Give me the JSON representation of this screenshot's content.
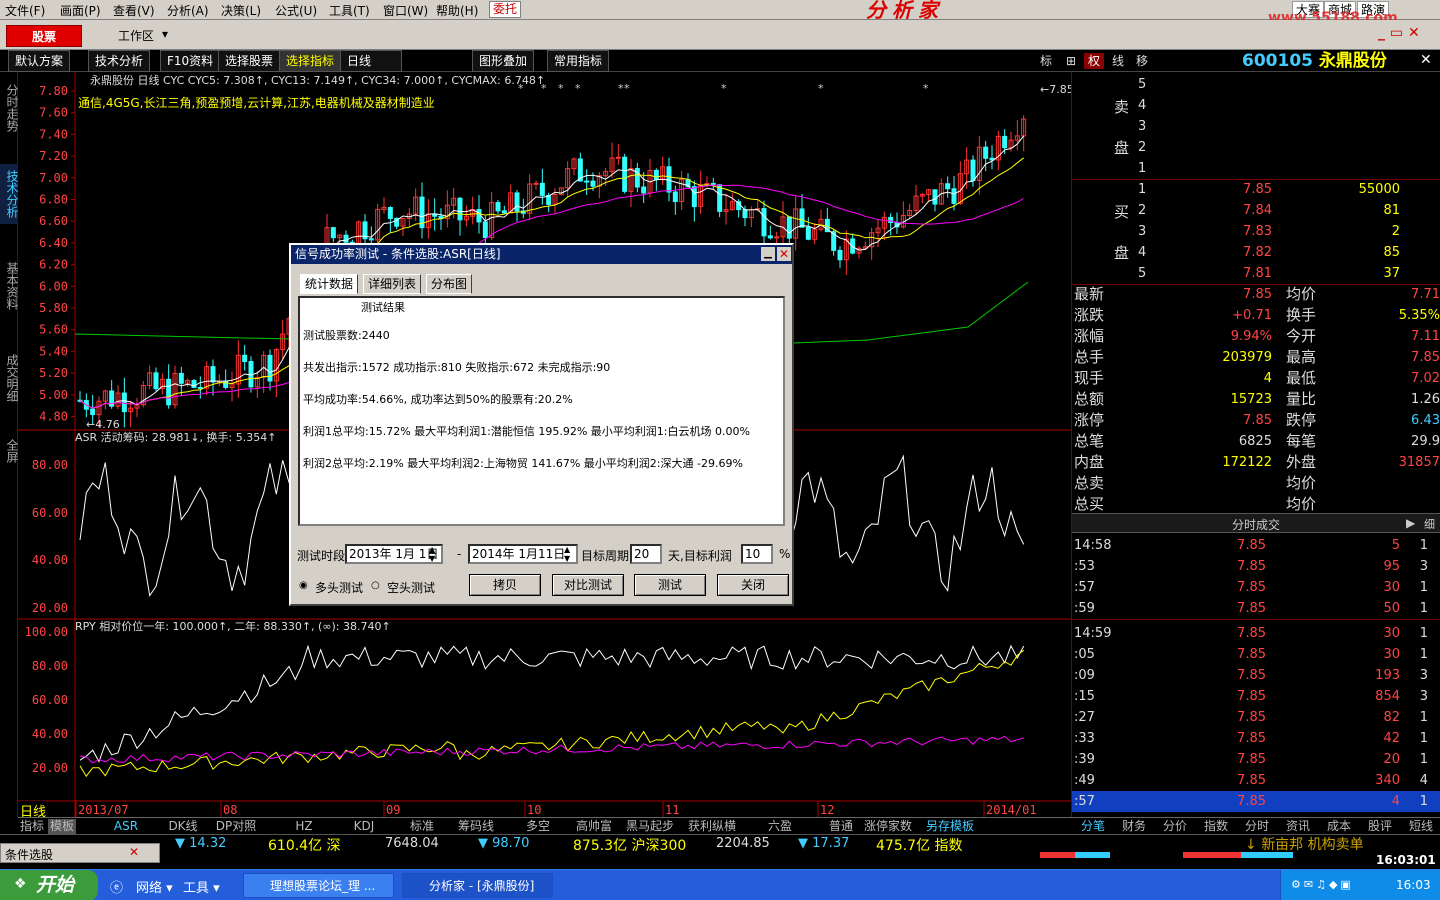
{
  "menu": [
    "文件(F)",
    "画面(P)",
    "查看(V)",
    "分析(A)",
    "决策(L)",
    "公式(U)",
    "工具(T)",
    "窗口(W)",
    "帮助(H)"
  ],
  "entrust": "委托",
  "brand": "分析家",
  "site": {
    "links": [
      "大赛",
      "商城",
      "路演"
    ],
    "url": "www.55188.com"
  },
  "topbar": {
    "stock_button": "股票",
    "workspace": "工作区"
  },
  "toolbar": {
    "items": [
      "默认方案",
      "技术分析",
      "F10资料",
      "选择股票",
      "选择指标",
      "日线",
      "图形叠加",
      "常用指标"
    ],
    "right_buttons": [
      "标",
      "⊞",
      "权",
      "线",
      "移"
    ],
    "stock_code": "600105",
    "stock_name": "永鼎股份"
  },
  "vtabs": [
    "分时走势",
    "技术分析",
    "基本资料",
    "成交明细",
    "全屏"
  ],
  "chart": {
    "kline_title": "永鼎股份 日线 CYC CYC5: 7.308↑, CYC13: 7.149↑, CYC34: 7.000↑, CYCMAX: 6.748↑",
    "concepts": "通信,4G5G,长江三角,预盈预增,云计算,江苏,电器机械及器材制造业",
    "price_ticks": [
      "7.80",
      "7.60",
      "7.40",
      "7.20",
      "7.00",
      "6.80",
      "6.60",
      "6.40",
      "6.20",
      "6.00",
      "5.80",
      "5.60",
      "5.40",
      "5.20",
      "5.00",
      "4.80"
    ],
    "high_label": "7.85",
    "low_label": "4.76",
    "asr_title": "ASR 活动筹码: 28.981↓, 换手: 5.354↑",
    "asr_ticks": [
      "80.00",
      "60.00",
      "40.00",
      "20.00"
    ],
    "rpy_title": "RPY 相对价位一年: 100.000↑, 二年: 88.330↑, (∞): 38.740↑",
    "rpy_ticks": [
      "100.00",
      "80.00",
      "60.00",
      "40.00",
      "20.00"
    ],
    "x_labels": [
      "2013/07",
      "08",
      "09",
      "10",
      "11",
      "12",
      "2014/01"
    ],
    "period_label": "日线"
  },
  "chart_data": {
    "type": "line",
    "series": [
      {
        "name": "CYC5",
        "values": [
          7.308
        ]
      },
      {
        "name": "CYC13",
        "values": [
          7.149
        ]
      },
      {
        "name": "CYC34",
        "values": [
          7.0
        ]
      },
      {
        "name": "CYCMAX",
        "values": [
          6.748
        ]
      }
    ]
  },
  "dialog": {
    "title": "信号成功率测试 - 条件选股:ASR[日线]",
    "tabs": [
      "统计数据",
      "详细列表",
      "分布图"
    ],
    "result_heading": "测试结果",
    "lines": [
      "测试股票数:2440",
      "共发出指示:1572 成功指示:810 失败指示:672 未完成指示:90",
      "平均成功率:54.66%, 成功率达到50%的股票有:20.2%",
      "利润1总平均:15.72% 最大平均利润1:潜能恒信 195.92% 最小平均利润1:白云机场 0.00%",
      "利润2总平均:2.19% 最大平均利润2:上海物贸 141.67% 最小平均利润2:深大通 -29.69%"
    ],
    "period_label": "测试时段",
    "date_from": "2013年 1月 1日",
    "dash": "-",
    "date_to": "2014年 1月11日",
    "target_period_label": "目标周期",
    "target_period": "20",
    "day_label": "天,目标利润",
    "target_profit": "10",
    "pct": "%",
    "radio_long": "多头测试",
    "radio_short": "空头测试",
    "buttons": [
      "拷贝",
      "对比测试",
      "测试",
      "关闭"
    ]
  },
  "orderbook": {
    "sell_label": [
      "卖",
      "盘"
    ],
    "buy_label": [
      "买",
      "盘"
    ],
    "sells": [
      {
        "n": "5"
      },
      {
        "n": "4"
      },
      {
        "n": "3"
      },
      {
        "n": "2"
      },
      {
        "n": "1"
      }
    ],
    "buys": [
      {
        "n": "1",
        "p": "7.85",
        "v": "55000"
      },
      {
        "n": "2",
        "p": "7.84",
        "v": "81"
      },
      {
        "n": "3",
        "p": "7.83",
        "v": "2"
      },
      {
        "n": "4",
        "p": "7.82",
        "v": "85"
      },
      {
        "n": "5",
        "p": "7.81",
        "v": "37"
      }
    ]
  },
  "quote": [
    {
      "l": "最新",
      "v": "7.85",
      "l2": "均价",
      "v2": "7.71"
    },
    {
      "l": "涨跌",
      "v": "+0.71",
      "l2": "换手",
      "v2": "5.35%"
    },
    {
      "l": "涨幅",
      "v": "9.94%",
      "l2": "今开",
      "v2": "7.11"
    },
    {
      "l": "总手",
      "v": "203979",
      "l2": "最高",
      "v2": "7.85"
    },
    {
      "l": "现手",
      "v": "4",
      "l2": "最低",
      "v2": "7.02"
    },
    {
      "l": "总额",
      "v": "15723",
      "l2": "量比",
      "v2": "1.26"
    },
    {
      "l": "涨停",
      "v": "7.85",
      "l2": "跌停",
      "v2": "6.43"
    },
    {
      "l": "总笔",
      "v": "6825",
      "l2": "每笔",
      "v2": "29.9"
    },
    {
      "l": "内盘",
      "v": "172122",
      "l2": "外盘",
      "v2": "31857"
    },
    {
      "l": "总卖",
      "v": "",
      "l2": "均价",
      "v2": ""
    },
    {
      "l": "总买",
      "v": "",
      "l2": "均价",
      "v2": ""
    }
  ],
  "ticks_header": "分时成交",
  "ticks_button": "细",
  "ticks": [
    {
      "t": "14:58",
      "p": "7.85",
      "v": "5",
      "n": "1"
    },
    {
      "t": ":53",
      "p": "7.85",
      "v": "95",
      "n": "3"
    },
    {
      "t": ":57",
      "p": "7.85",
      "v": "30",
      "n": "1"
    },
    {
      "t": ":59",
      "p": "7.85",
      "v": "50",
      "n": "1"
    },
    {
      "t": "14:59",
      "p": "7.85",
      "v": "30",
      "n": "1"
    },
    {
      "t": ":05",
      "p": "7.85",
      "v": "30",
      "n": "1"
    },
    {
      "t": ":09",
      "p": "7.85",
      "v": "193",
      "n": "3"
    },
    {
      "t": ":15",
      "p": "7.85",
      "v": "854",
      "n": "3"
    },
    {
      "t": ":27",
      "p": "7.85",
      "v": "82",
      "n": "1"
    },
    {
      "t": ":33",
      "p": "7.85",
      "v": "42",
      "n": "1"
    },
    {
      "t": ":39",
      "p": "7.85",
      "v": "20",
      "n": "1"
    },
    {
      "t": ":49",
      "p": "7.85",
      "v": "340",
      "n": "4"
    },
    {
      "t": ":57",
      "p": "7.85",
      "v": "4",
      "n": "1"
    }
  ],
  "bottom_tabs": [
    "指标",
    "模板",
    "ASR",
    "DK线",
    "DP对照",
    "HZ",
    "KDJ",
    "标准",
    "筹码线",
    "多空",
    "高帅富",
    "黑马起步",
    "获利纵横",
    "六盈",
    "普通",
    "涨停家数",
    "另存模板"
  ],
  "right_tabs": [
    "分笔",
    "财务",
    "分价",
    "指数",
    "分时",
    "资讯",
    "成本",
    "股评",
    "短线"
  ],
  "status": {
    "cond": "条件选股",
    "sh_change": "14.32",
    "sh_amount": "610.4亿",
    "sz_label": "深",
    "sz_index": "7648.04",
    "sz_change": "98.70",
    "hs_amount": "875.3亿",
    "hs_label": "沪深300",
    "hs_index": "2204.85",
    "hs_change": "17.37",
    "idx_amount": "475.7亿",
    "idx_label": "指数",
    "news": "新亩邦 机构卖单",
    "time": "16:03:01"
  },
  "taskbar": {
    "start": "开始",
    "quick": [
      "网络",
      "工具"
    ],
    "tasks": [
      "理想股票论坛_理 ...",
      "分析家 - [永鼎股份]"
    ],
    "clock": "16:03"
  }
}
